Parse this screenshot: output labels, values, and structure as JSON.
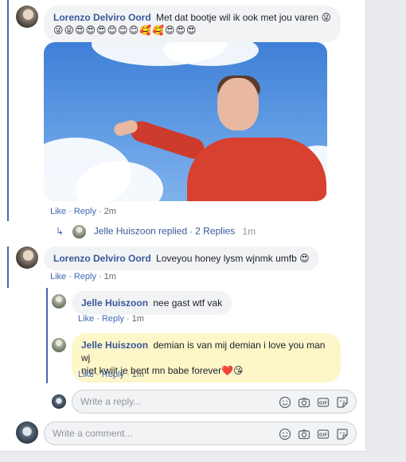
{
  "comment1": {
    "author": "Lorenzo Delviro Oord",
    "text": "Met dat bootje wil ik ook met jou varen 😜",
    "emojis": "😜😜😍😍😍😊😊😊🥰🥰😍😍😍",
    "like": "Like",
    "reply": "Reply",
    "time": "2m"
  },
  "replied_summary": {
    "name": "Jelle Huiszoon replied",
    "count": "2 Replies",
    "time": "1m"
  },
  "comment2": {
    "author": "Lorenzo Delviro Oord",
    "text": "Loveyou honey lysm wjnmk umfb 😍",
    "like": "Like",
    "reply": "Reply",
    "time": "1m"
  },
  "reply1": {
    "author": "Jelle Huiszoon",
    "text": "nee gast wtf vak",
    "like": "Like",
    "reply": "Reply",
    "time": "1m"
  },
  "reply2": {
    "author": "Jelle Huiszoon",
    "text_line1": "demian is van mij demian i love you man wj",
    "text_line2": "niet kwijt je bent mn babe forever❤️😘",
    "like": "Like",
    "reply": "Reply",
    "time": "1m"
  },
  "reply_input": {
    "placeholder": "Write a reply..."
  },
  "comment_input": {
    "placeholder": "Write a comment..."
  },
  "icons": [
    "smiley-icon",
    "camera-icon",
    "gif-icon",
    "sticker-icon"
  ],
  "colors": {
    "link": "#385898",
    "action": "#4267b2",
    "thread": "#4267b2",
    "highlight": "#fdf6c9"
  }
}
